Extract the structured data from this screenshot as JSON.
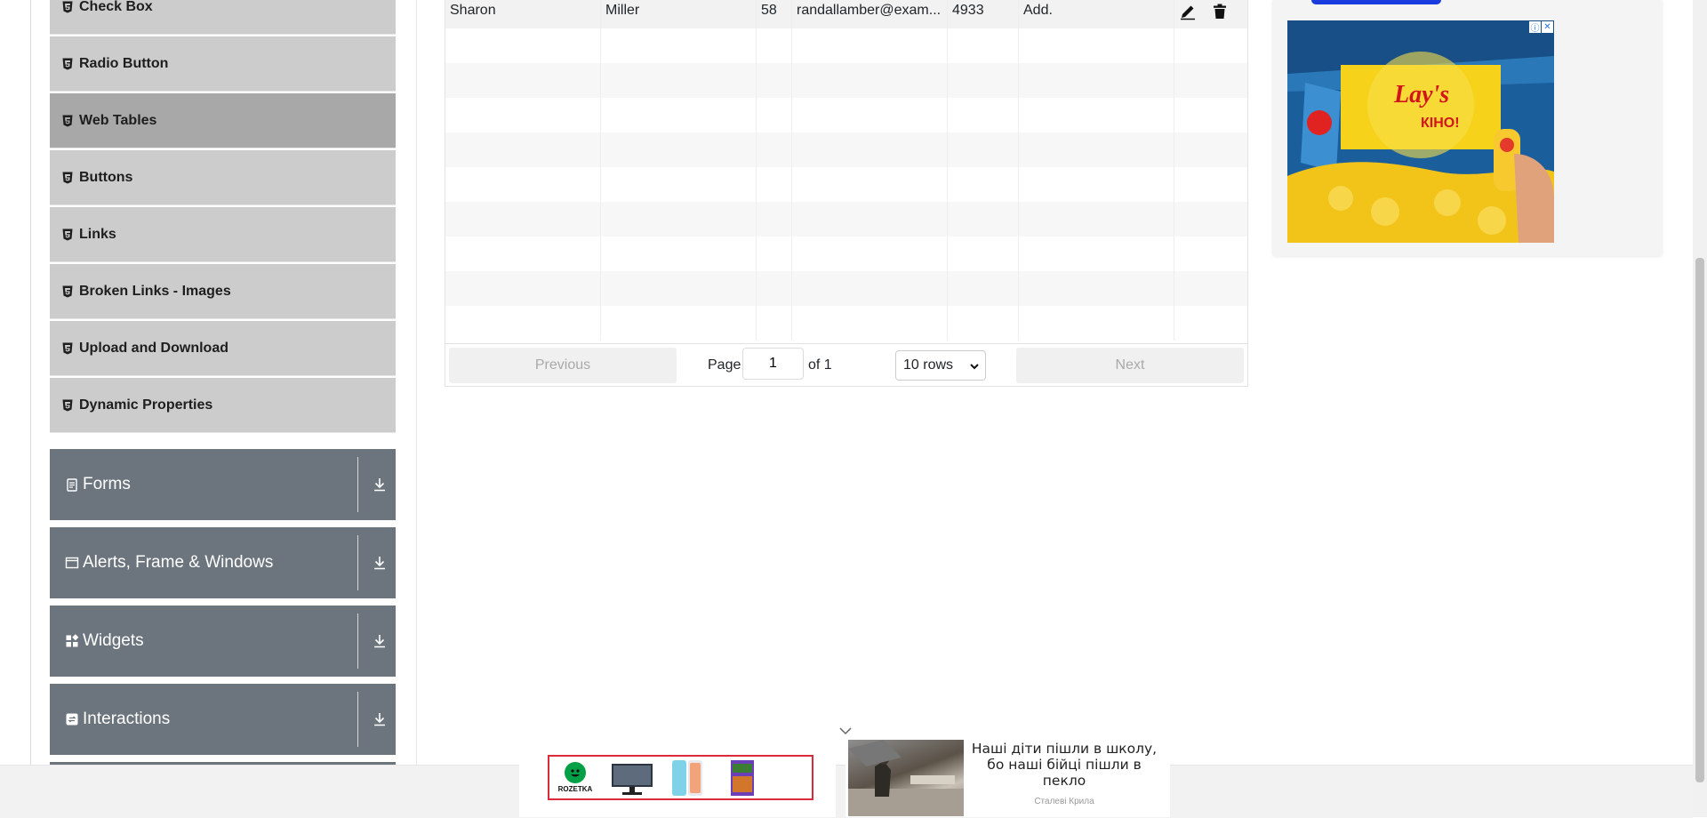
{
  "sidebar": {
    "items": [
      {
        "label": "Check Box",
        "active": false
      },
      {
        "label": "Radio Button",
        "active": false
      },
      {
        "label": "Web Tables",
        "active": true
      },
      {
        "label": "Buttons",
        "active": false
      },
      {
        "label": "Links",
        "active": false
      },
      {
        "label": "Broken Links - Images",
        "active": false
      },
      {
        "label": "Upload and Download",
        "active": false
      },
      {
        "label": "Dynamic Properties",
        "active": false
      }
    ],
    "groups": [
      {
        "label": "Forms",
        "icon": "document-icon"
      },
      {
        "label": "Alerts, Frame & Windows",
        "icon": "window-icon"
      },
      {
        "label": "Widgets",
        "icon": "widgets-icon"
      },
      {
        "label": "Interactions",
        "icon": "interactions-icon"
      }
    ]
  },
  "table": {
    "rows": [
      {
        "first_name": "Sharon",
        "last_name": "Miller",
        "age": "58",
        "email": "randallamber@exam...",
        "salary": "4933",
        "department": "Add."
      }
    ],
    "empty_rows": 9
  },
  "pagination": {
    "previous_label": "Previous",
    "page_label": "Page",
    "page_value": "1",
    "of_label": "of 1",
    "rows_label": "10 rows",
    "next_label": "Next"
  },
  "bottom_ads": {
    "rozetka_label": "ROZETKA",
    "news_title": "Наші діти пішли в школу, бо наші бійці пішли в пекло",
    "news_source": "Сталеві Крила"
  },
  "colors": {
    "sidebar_item_bg": "#cccccc",
    "sidebar_item_active_bg": "#a8a8a8",
    "group_bg": "#6c757d",
    "ad_button": "#1a3cdf",
    "rozetka_green": "#00a046",
    "rozetka_border": "#dd2a3a"
  }
}
